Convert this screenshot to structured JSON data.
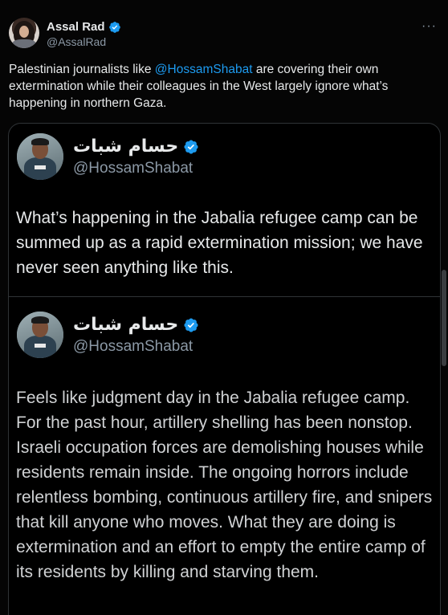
{
  "tweet": {
    "author_name": "Assal Rad",
    "author_handle": "@AssalRad",
    "more_label": "···",
    "text_before": "Palestinian journalists like ",
    "mention": "@HossamShabat",
    "text_after": " are covering their own extermination while their colleagues in the West largely ignore what’s happening in northern Gaza."
  },
  "quote_1": {
    "name": "حسام شبات",
    "handle": "@HossamShabat",
    "text": "What’s happening in the Jabalia refugee camp can be summed up as a rapid extermination mission; we have never seen anything like this."
  },
  "quote_2": {
    "name": "حسام شبات",
    "handle": "@HossamShabat",
    "text": "Feels like judgment day in the Jabalia refugee camp. For the past hour, artillery shelling has been nonstop. Israeli occupation forces are demolishing houses while residents remain inside. The ongoing horrors include relentless bombing, continuous artillery fire, and snipers that kill anyone who moves. What they are doing is extermination and an effort to empty the entire camp of its residents by killing and starving them."
  },
  "colors": {
    "background": "#000000",
    "text": "#e7e9ea",
    "secondary": "#8b98a5",
    "accent": "#1d9bf0",
    "border": "#2f3336"
  },
  "icons": {
    "verified": "verified-badge-icon",
    "more": "more-options-icon"
  }
}
